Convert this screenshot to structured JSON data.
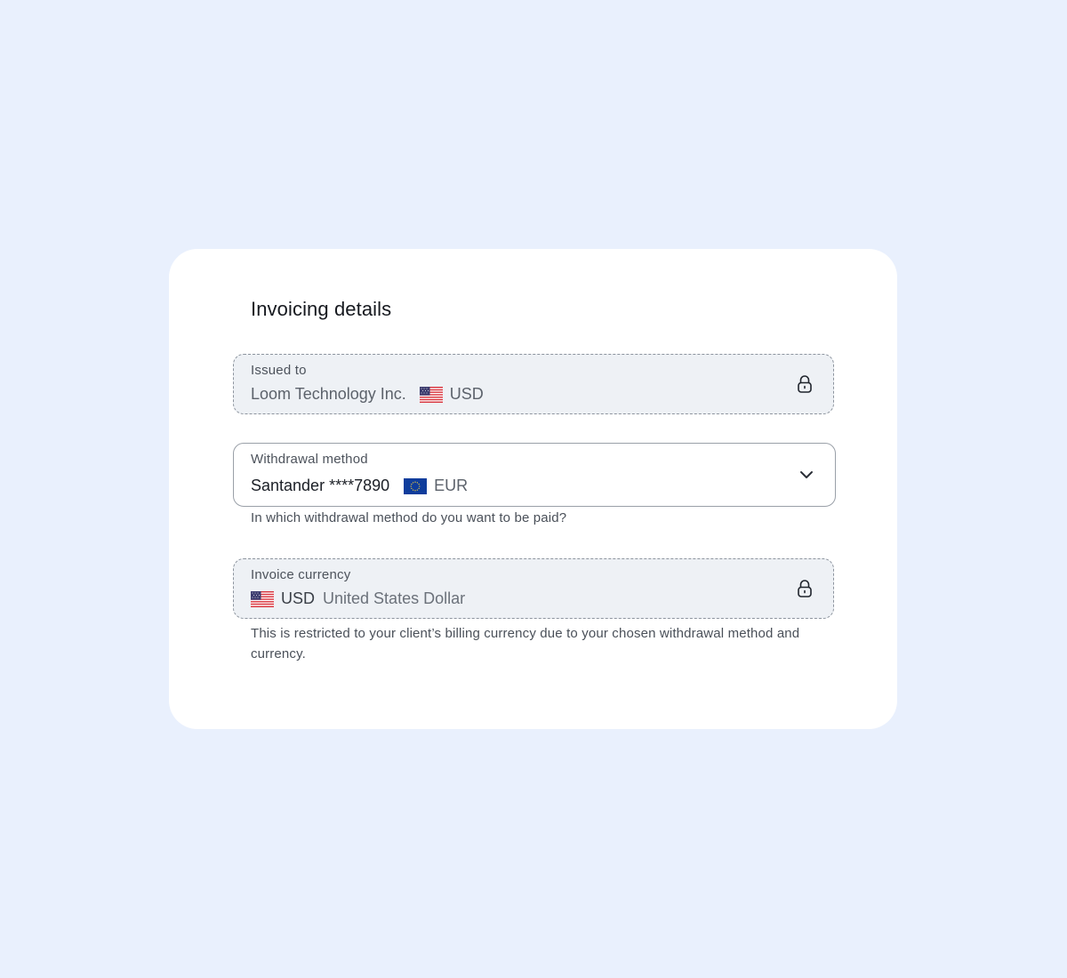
{
  "card": {
    "title": "Invoicing details"
  },
  "issued_to": {
    "label": "Issued to",
    "value": "Loom Technology Inc.",
    "currency_code": "USD",
    "flag_icon": "us-flag-icon",
    "state_icon": "lock-icon"
  },
  "withdrawal_method": {
    "label": "Withdrawal method",
    "value": "Santander ****7890",
    "currency_code": "EUR",
    "flag_icon": "eu-flag-icon",
    "state_icon": "chevron-down-icon",
    "helper": "In which withdrawal method do you want to be paid?"
  },
  "invoice_currency": {
    "label": "Invoice currency",
    "currency_code": "USD",
    "currency_name": "United States Dollar",
    "flag_icon": "us-flag-icon",
    "state_icon": "lock-icon",
    "helper": "This is restricted to your client’s billing currency due to your chosen withdrawal method and currency."
  },
  "colors": {
    "page_background": "#e9f0fd",
    "card_background": "#ffffff",
    "locked_field_background": "#eef1f5",
    "locked_field_border": "#8d949e",
    "select_border": "#9aa0a8"
  }
}
